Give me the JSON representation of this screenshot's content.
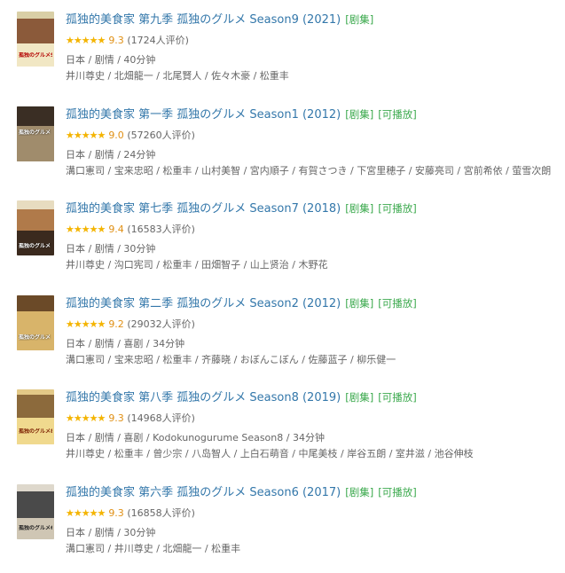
{
  "colors": {
    "link": "#3377aa",
    "tag": "#3ba94d",
    "star": "#f4b400",
    "score": "#e09015",
    "meta": "#666666"
  },
  "items": [
    {
      "title": "孤独的美食家 第九季 孤独のグルメ Season9 (2021)",
      "tags": [
        "[剧集]"
      ],
      "stars": "★★★★★",
      "score": "9.3",
      "count": "(1724人评价)",
      "meta": "日本 / 剧情 / 40分钟",
      "cast": "井川尊史 / 北畑龍一 / 北尾賢人 / 佐々木豪 / 松重丰",
      "poster_text": "孤独のグルメ9"
    },
    {
      "title": "孤独的美食家 第一季 孤独のグルメ Season1 (2012)",
      "tags": [
        "[剧集]",
        "[可播放]"
      ],
      "stars": "★★★★★",
      "score": "9.0",
      "count": "(57260人评价)",
      "meta": "日本 / 剧情 / 24分钟",
      "cast": "溝口憲司 / 宝来忠昭 / 松重丰 / 山村美智 / 宮内順子 / 有賀さつき / 下宮里穂子 / 安藤亮司 / 宮前希依 / 萤雪次朗",
      "poster_text": "孤独のグルメ"
    },
    {
      "title": "孤独的美食家 第七季 孤独のグルメ Season7 (2018)",
      "tags": [
        "[剧集]",
        "[可播放]"
      ],
      "stars": "★★★★★",
      "score": "9.4",
      "count": "(16583人评价)",
      "meta": "日本 / 剧情 / 30分钟",
      "cast": "井川尊史 / 沟口宪司 / 松重丰 / 田畑智子 / 山上贤治 / 木野花",
      "poster_text": "孤独のグルメ"
    },
    {
      "title": "孤独的美食家 第二季 孤独のグルメ Season2 (2012)",
      "tags": [
        "[剧集]",
        "[可播放]"
      ],
      "stars": "★★★★★",
      "score": "9.2",
      "count": "(29032人评价)",
      "meta": "日本 / 剧情 / 喜剧 / 34分钟",
      "cast": "溝口憲司 / 宝来忠昭 / 松重丰 / 齐藤晓 / おぼんこぼん / 佐藤蓝子 / 柳乐健一",
      "poster_text": "孤独のグルメ"
    },
    {
      "title": "孤独的美食家 第八季 孤独のグルメ Season8 (2019)",
      "tags": [
        "[剧集]",
        "[可播放]"
      ],
      "stars": "★★★★★",
      "score": "9.3",
      "count": "(14968人评价)",
      "meta": "日本 / 剧情 / 喜剧 / Kodokunogurume Season8 / 34分钟",
      "cast": "井川尊史 / 松重丰 / 曾少宗 / 八岛智人 / 上白石萌音 / 中尾美枝 / 岸谷五朗 / 室井滋 / 池谷伸枝",
      "poster_text": "孤独のグルメ8"
    },
    {
      "title": "孤独的美食家 第六季 孤独のグルメ Season6 (2017)",
      "tags": [
        "[剧集]",
        "[可播放]"
      ],
      "stars": "★★★★★",
      "score": "9.3",
      "count": "(16858人评价)",
      "meta": "日本 / 剧情 / 30分钟",
      "cast": "溝口憲司 / 井川尊史 / 北畑龍一 / 松重丰",
      "poster_text": "孤独のグルメ6"
    }
  ]
}
